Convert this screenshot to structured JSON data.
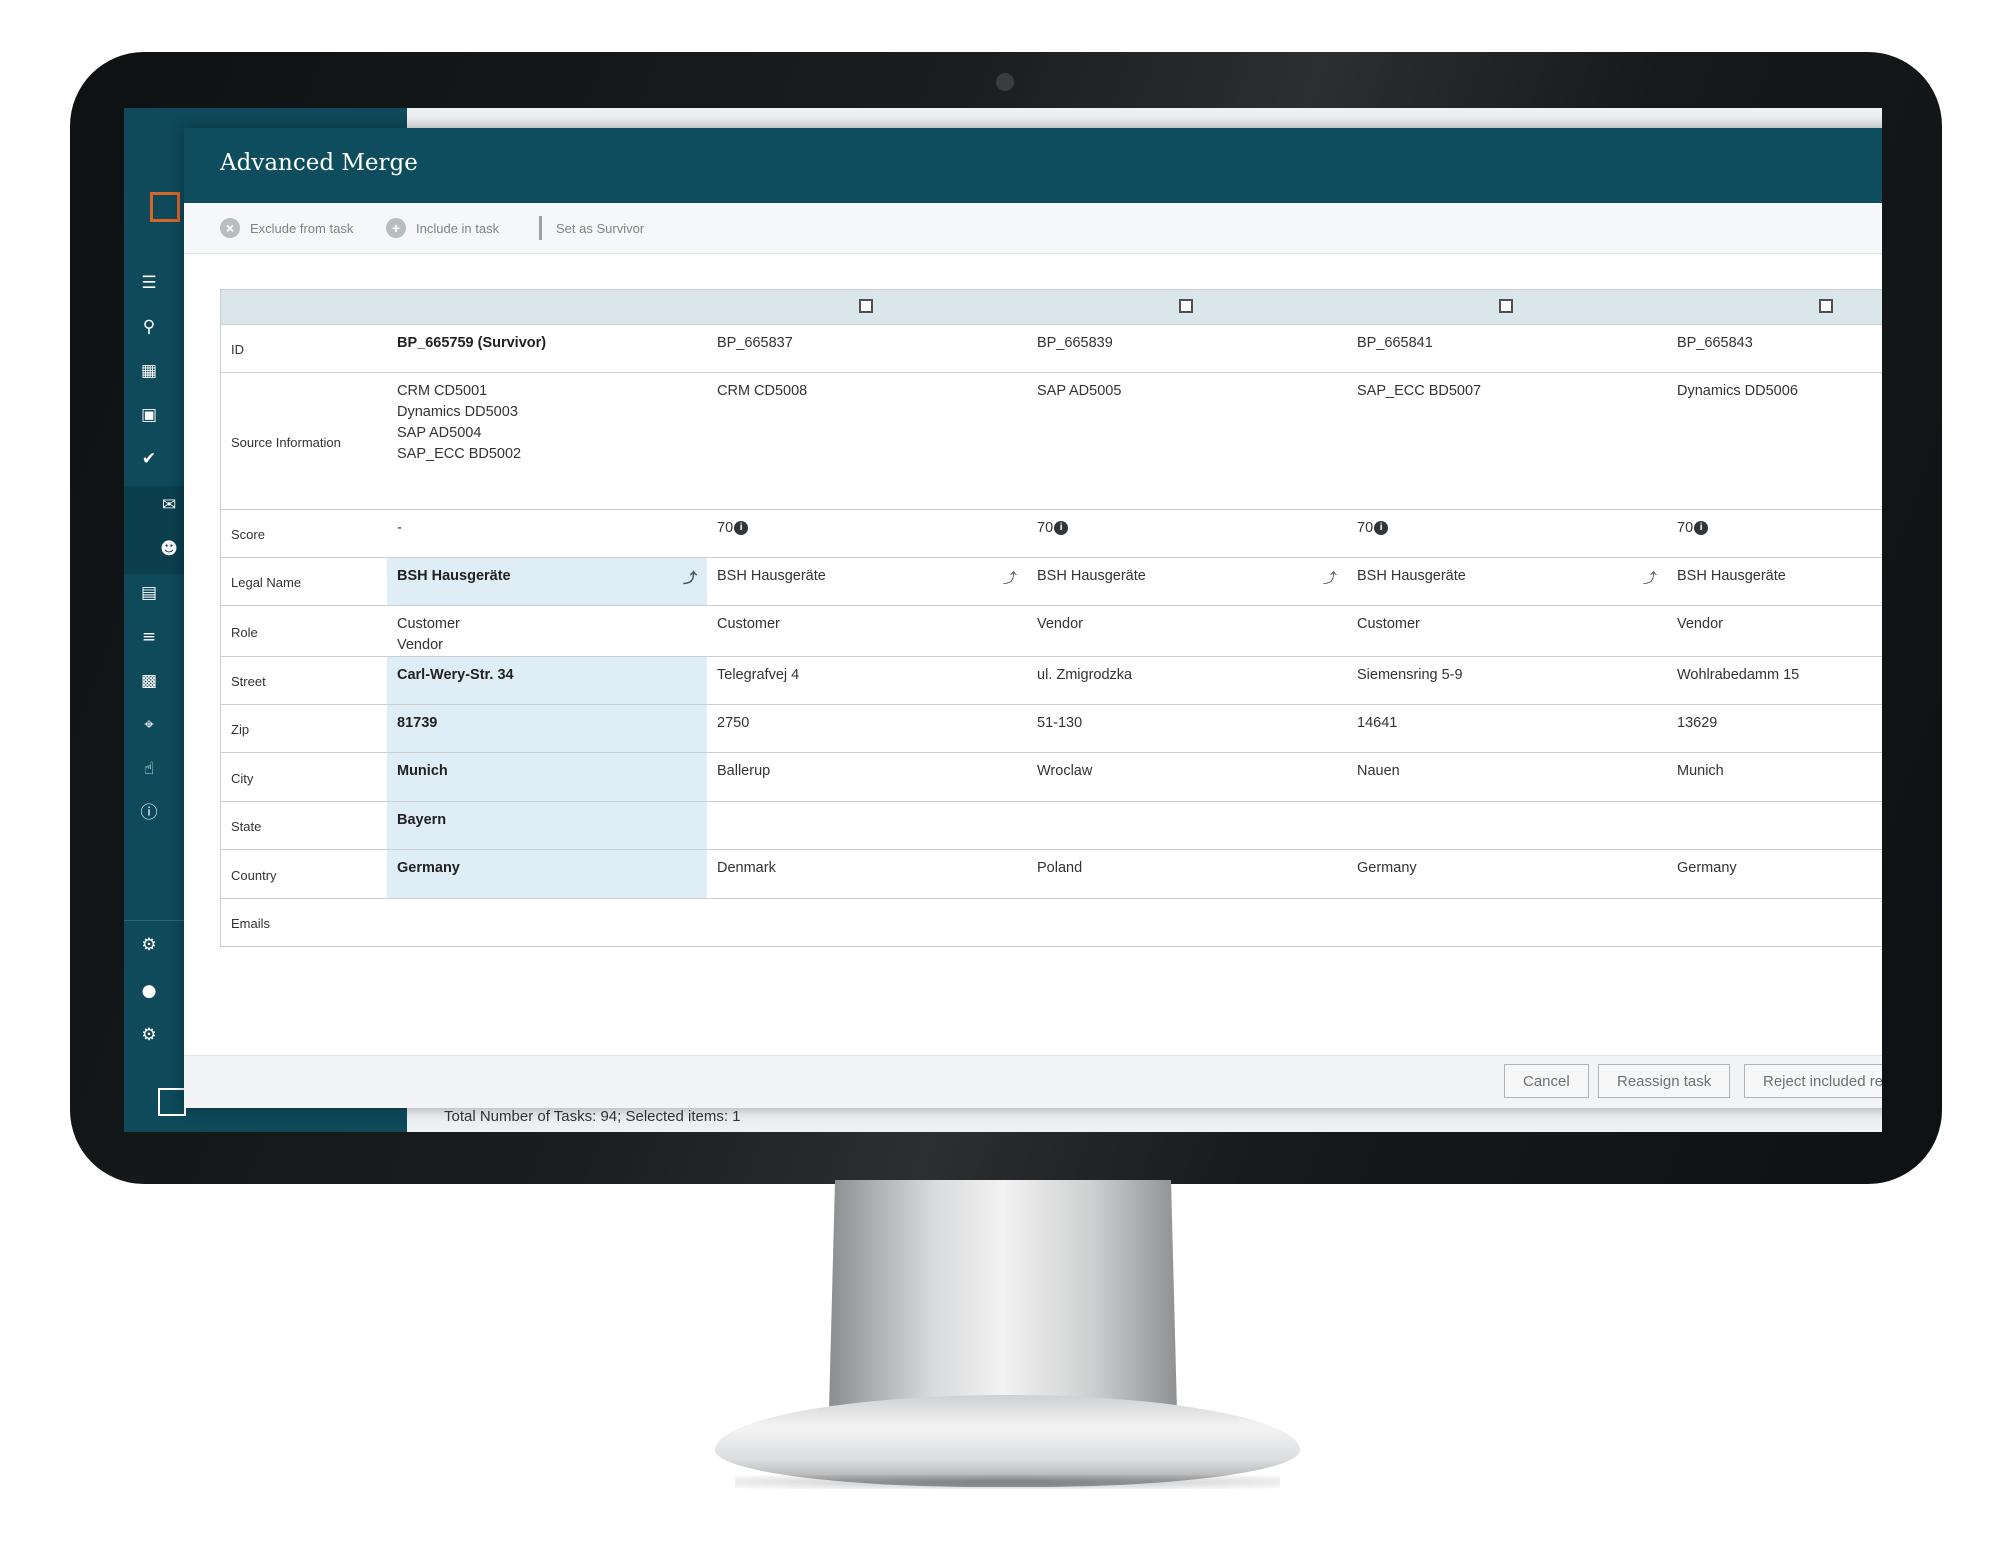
{
  "modal": {
    "title": "Advanced Merge",
    "toolbar": {
      "exclude_label": "Exclude from task",
      "include_label": "Include in task",
      "survivor_label": "Set as Survivor"
    },
    "footer": {
      "cancel_label": "Cancel",
      "reassign_label": "Reassign task",
      "reject_label": "Reject included re"
    }
  },
  "status_bar": {
    "text": "Total Number of Tasks: 94; Selected items: 1"
  },
  "colors": {
    "header": "#0d4d5e",
    "sidebar": "#0e4a5a",
    "survivor_highlight": "#dfeef6",
    "accent_logo": "#d9652b"
  },
  "sidebar_icons": [
    "org-chart-icon",
    "search-icon",
    "hierarchy-icon",
    "dashboard-icon",
    "check-circle-icon",
    "chat-icon",
    "user-settings-icon",
    "data-model-icon",
    "filter-list-icon",
    "report-icon",
    "crop-icon",
    "touch-icon",
    "info-icon",
    "notifications-icon",
    "user-icon",
    "settings-icon"
  ],
  "records": [
    {
      "id": "BP_665759 (Survivor)",
      "source": "CRM CD5001\nDynamics DD5003\nSAP AD5004\nSAP_ECC BD5002",
      "score": "-",
      "legal_name": "BSH Hausgeräte",
      "role": "Customer\nVendor",
      "street": "Carl-Wery-Str. 34",
      "zip": "81739",
      "city": "Munich",
      "state": "Bayern",
      "country": "Germany",
      "emails": ""
    },
    {
      "id": "BP_665837",
      "source": "CRM CD5008",
      "score": "70",
      "legal_name": "BSH Hausgeräte",
      "role": "Customer",
      "street": "Telegrafvej 4",
      "zip": "2750",
      "city": "Ballerup",
      "state": "",
      "country": "Denmark",
      "emails": ""
    },
    {
      "id": "BP_665839",
      "source": "SAP AD5005",
      "score": "70",
      "legal_name": "BSH Hausgeräte",
      "role": "Vendor",
      "street": "ul. Zmigrodzka",
      "zip": "51-130",
      "city": "Wroclaw",
      "state": "",
      "country": "Poland",
      "emails": ""
    },
    {
      "id": "BP_665841",
      "source": "SAP_ECC BD5007",
      "score": "70",
      "legal_name": "BSH Hausgeräte",
      "role": "Customer",
      "street": "Siemensring 5-9",
      "zip": "14641",
      "city": "Nauen",
      "state": "",
      "country": "Germany",
      "emails": ""
    },
    {
      "id": "BP_665843",
      "source": "Dynamics DD5006",
      "score": "70",
      "legal_name": "BSH Hausgeräte",
      "role": "Vendor",
      "street": "Wohlrabedamm 15",
      "zip": "13629",
      "city": "Munich",
      "state": "",
      "country": "Germany",
      "emails": ""
    }
  ],
  "row_labels": {
    "id": "ID",
    "source": "Source Information",
    "score": "Score",
    "legal_name": "Legal Name",
    "role": "Role",
    "street": "Street",
    "zip": "Zip",
    "city": "City",
    "state": "State",
    "country": "Country",
    "emails": "Emails"
  }
}
